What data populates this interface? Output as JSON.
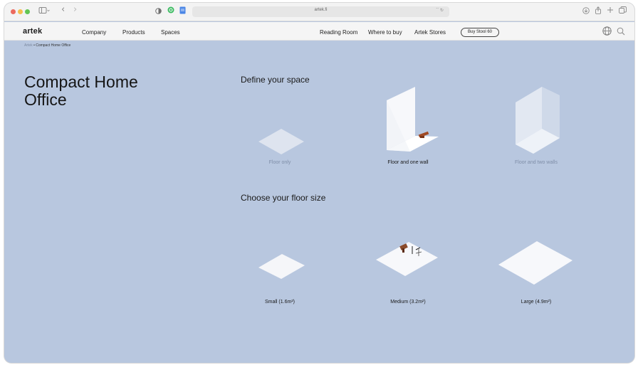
{
  "browser": {
    "url": "artek.fi",
    "url_right": "`` ↻",
    "nav_back": "‹",
    "nav_forward": "›"
  },
  "site": {
    "logo": "artek",
    "nav_left": [
      "Company",
      "Products",
      "Spaces"
    ],
    "nav_right": [
      "Reading Room",
      "Where to buy",
      "Artek Stores"
    ],
    "cta": "Buy Stool 60"
  },
  "breadcrumb": {
    "home": "Artek",
    "separator": "•",
    "current": "Compact Home Office"
  },
  "page": {
    "title": "Compact Home Office"
  },
  "space_section": {
    "heading": "Define your space",
    "options": [
      "Floor only",
      "Floor and one wall",
      "Floor and two walls"
    ]
  },
  "size_section": {
    "heading": "Choose your floor size",
    "options": [
      "Small (1.6m²)",
      "Medium (3.2m²)",
      "Large (4.9m²)"
    ]
  },
  "colors": {
    "background": "#b8c7df",
    "selected_text": "#1a1a1a",
    "muted_text": "#7f8ea8",
    "floor": "#f4f5f8",
    "furniture": "#8a4a2a"
  },
  "icons": [
    "sidebar-icon",
    "shield-icon",
    "extension-icon",
    "document-icon",
    "download-icon",
    "share-icon",
    "new-tab-icon",
    "tabs-icon",
    "globe-icon",
    "search-icon"
  ]
}
